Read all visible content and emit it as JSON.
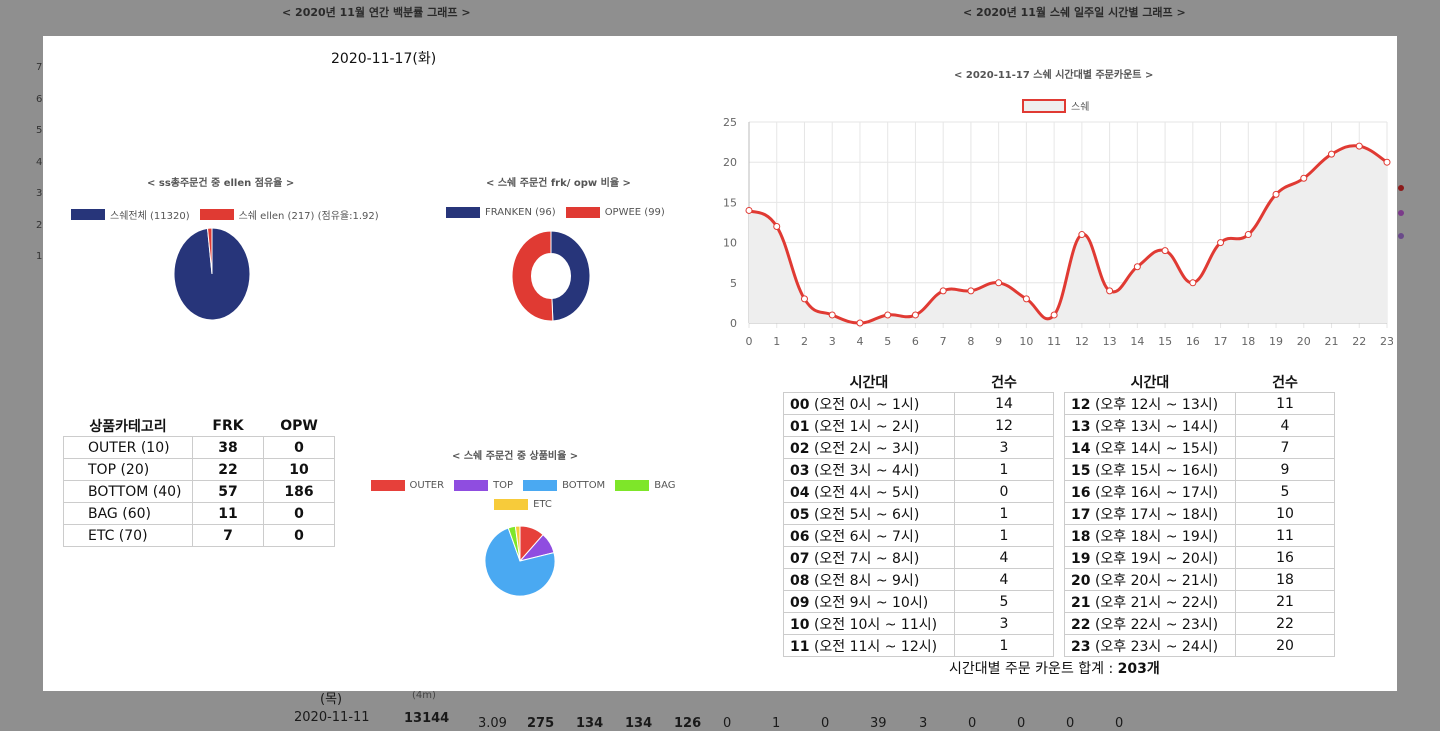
{
  "background": {
    "left_title": "< 2020년 11월 연간 백분률 그래프 >",
    "right_title": "< 2020년 11월 스쉐 일주일 시간별 그래프 >",
    "y_labels": [
      "7",
      "6",
      "5",
      "4",
      "3",
      "2",
      "1"
    ],
    "row_label_top": "(목)",
    "row_label_sub": "(4m)",
    "row_date": "2020-11-11",
    "row_value": "13144",
    "row_cells": [
      "3.09",
      "275",
      "134",
      "134",
      "126",
      "0",
      "1",
      "0",
      "39",
      "3",
      "0",
      "0",
      "0",
      "0"
    ]
  },
  "modal": {
    "date_title": "2020-11-17(화)"
  },
  "pie1": {
    "title": "< ss총주문건 중 ellen 점유율 >",
    "legend": [
      {
        "label": "스쉐전체 (11320)",
        "color": "#27357a"
      },
      {
        "label": "스쉐 ellen (217) (점유율:1.92)",
        "color": "#e03a33"
      }
    ],
    "values": [
      11320,
      217
    ]
  },
  "donut": {
    "title": "< 스쉐 주문건 frk/ opw 비율 >",
    "legend": [
      {
        "label": "FRANKEN (96)",
        "color": "#27357a"
      },
      {
        "label": "OPWEE (99)",
        "color": "#e03a33"
      }
    ],
    "values": [
      96,
      99
    ]
  },
  "category_table": {
    "headers": [
      "상품카테고리",
      "FRK",
      "OPW"
    ],
    "rows": [
      {
        "name": "OUTER (10)",
        "frk": "38",
        "opw": "0"
      },
      {
        "name": "TOP (20)",
        "frk": "22",
        "opw": "10"
      },
      {
        "name": "BOTTOM (40)",
        "frk": "57",
        "opw": "186"
      },
      {
        "name": "BAG (60)",
        "frk": "11",
        "opw": "0"
      },
      {
        "name": "ETC (70)",
        "frk": "7",
        "opw": "0"
      }
    ]
  },
  "pie2": {
    "title": "< 스쉐 주문건 중 상품비율 >",
    "legend": [
      {
        "label": "OUTER",
        "color": "#e6403a"
      },
      {
        "label": "TOP",
        "color": "#8f4de0"
      },
      {
        "label": "BOTTOM",
        "color": "#4aa9f2"
      },
      {
        "label": "BAG",
        "color": "#7ee629"
      },
      {
        "label": "ETC",
        "color": "#f7cb3a"
      }
    ],
    "values": [
      38,
      32,
      243,
      11,
      7
    ]
  },
  "chart_data": {
    "type": "line",
    "title": "< 2020-11-17 스쉐 시간대별 주문카운트 >",
    "series": [
      {
        "name": "스쉐",
        "values": [
          14,
          12,
          3,
          1,
          0,
          1,
          1,
          4,
          4,
          5,
          3,
          1,
          11,
          4,
          7,
          9,
          5,
          10,
          11,
          16,
          18,
          21,
          22,
          20
        ]
      }
    ],
    "x": [
      "0",
      "1",
      "2",
      "3",
      "4",
      "5",
      "6",
      "7",
      "8",
      "9",
      "10",
      "11",
      "12",
      "13",
      "14",
      "15",
      "16",
      "17",
      "18",
      "19",
      "20",
      "21",
      "22",
      "23"
    ],
    "yticks": [
      "0",
      "5",
      "10",
      "15",
      "20",
      "25"
    ],
    "ylim": [
      0,
      25
    ],
    "grid": true,
    "legend": "top-center",
    "line_color": "#e03a33",
    "fill_color": "#eeeeee"
  },
  "hour_table": {
    "headers": [
      "시간대",
      "건수"
    ],
    "left": [
      {
        "h": "00",
        "range": "(오전 0시 ~ 1시)",
        "count": "14"
      },
      {
        "h": "01",
        "range": "(오전 1시 ~ 2시)",
        "count": "12"
      },
      {
        "h": "02",
        "range": "(오전 2시 ~ 3시)",
        "count": "3"
      },
      {
        "h": "03",
        "range": "(오전 3시 ~ 4시)",
        "count": "1"
      },
      {
        "h": "04",
        "range": "(오전 4시 ~ 5시)",
        "count": "0"
      },
      {
        "h": "05",
        "range": "(오전 5시 ~ 6시)",
        "count": "1"
      },
      {
        "h": "06",
        "range": "(오전 6시 ~ 7시)",
        "count": "1"
      },
      {
        "h": "07",
        "range": "(오전 7시 ~ 8시)",
        "count": "4"
      },
      {
        "h": "08",
        "range": "(오전 8시 ~ 9시)",
        "count": "4"
      },
      {
        "h": "09",
        "range": "(오전 9시 ~ 10시)",
        "count": "5"
      },
      {
        "h": "10",
        "range": "(오전 10시 ~ 11시)",
        "count": "3"
      },
      {
        "h": "11",
        "range": "(오전 11시 ~ 12시)",
        "count": "1"
      }
    ],
    "right": [
      {
        "h": "12",
        "range": "(오후 12시 ~ 13시)",
        "count": "11"
      },
      {
        "h": "13",
        "range": "(오후 13시 ~ 14시)",
        "count": "4"
      },
      {
        "h": "14",
        "range": "(오후 14시 ~ 15시)",
        "count": "7"
      },
      {
        "h": "15",
        "range": "(오후 15시 ~ 16시)",
        "count": "9"
      },
      {
        "h": "16",
        "range": "(오후 16시 ~ 17시)",
        "count": "5"
      },
      {
        "h": "17",
        "range": "(오후 17시 ~ 18시)",
        "count": "10"
      },
      {
        "h": "18",
        "range": "(오후 18시 ~ 19시)",
        "count": "11"
      },
      {
        "h": "19",
        "range": "(오후 19시 ~ 20시)",
        "count": "16"
      },
      {
        "h": "20",
        "range": "(오후 20시 ~ 21시)",
        "count": "18"
      },
      {
        "h": "21",
        "range": "(오후 21시 ~ 22시)",
        "count": "21"
      },
      {
        "h": "22",
        "range": "(오후 22시 ~ 23시)",
        "count": "22"
      },
      {
        "h": "23",
        "range": "(오후 23시 ~ 24시)",
        "count": "20"
      }
    ],
    "total_label": "시간대별 주문 카운트 합계 : ",
    "total_value": "203개"
  }
}
